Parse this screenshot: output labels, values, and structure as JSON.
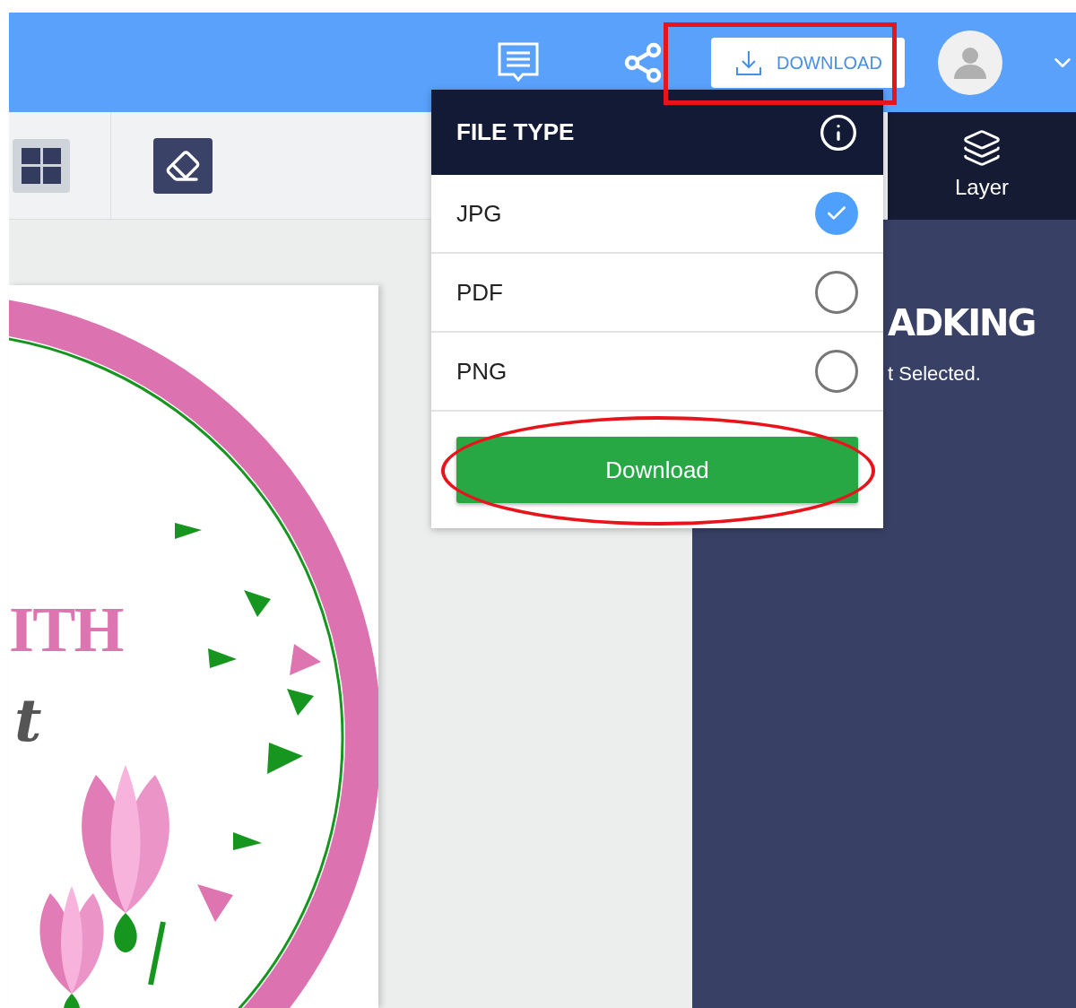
{
  "header": {
    "download_button": "DOWNLOAD"
  },
  "side_tab": {
    "label": "Layer"
  },
  "panel": {
    "logo": "ADKING",
    "message": "t Selected."
  },
  "canvas": {
    "texts": [
      {
        "kind": "heading",
        "text": "ITH"
      },
      {
        "kind": "script",
        "text": "t"
      }
    ]
  },
  "dropdown": {
    "title": "FILE TYPE",
    "options": [
      {
        "label": "JPG",
        "selected": true
      },
      {
        "label": "PDF",
        "selected": false
      },
      {
        "label": "PNG",
        "selected": false
      }
    ],
    "button": "Download"
  }
}
